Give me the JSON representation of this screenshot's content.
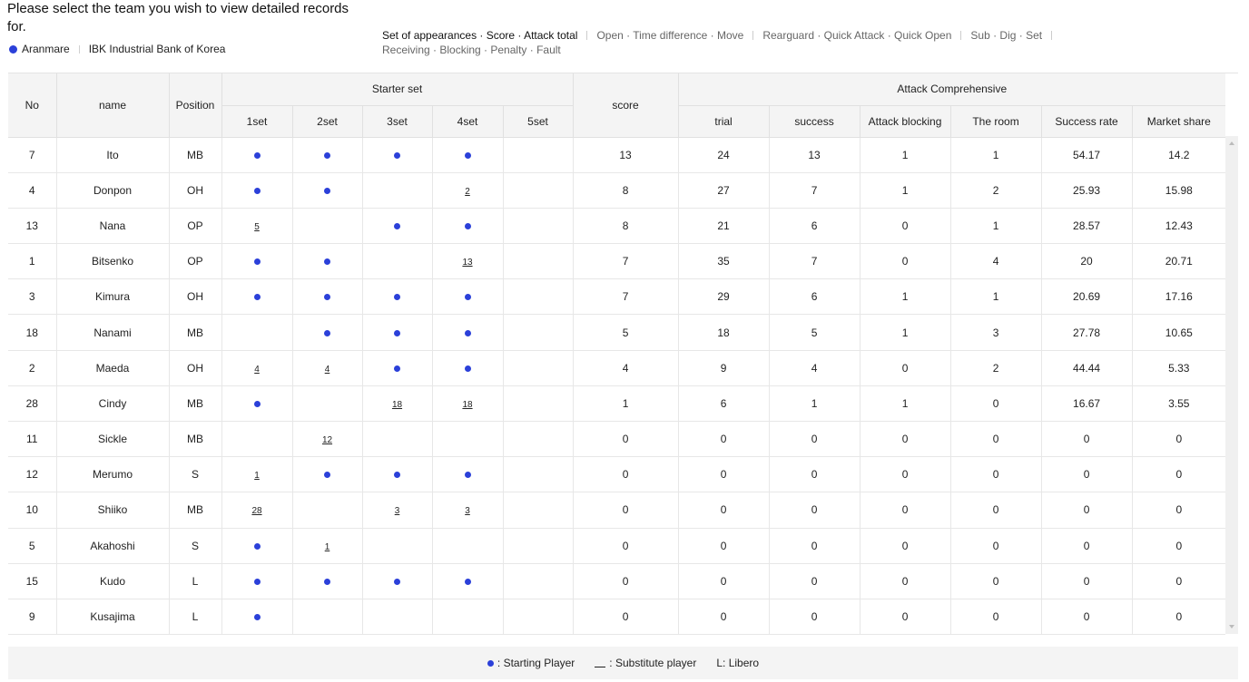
{
  "header": {
    "title": "Please select the team you wish to view detailed records for."
  },
  "teams": [
    {
      "label": "Aranmare",
      "selected": true
    },
    {
      "label": "IBK Industrial Bank of Korea",
      "selected": false
    }
  ],
  "categories": {
    "row1": [
      "Set of appearances · Score · Attack total",
      "Open · Time difference · Move",
      "Rearguard · Quick Attack · Quick Open",
      "Sub · Dig · Set"
    ],
    "row2": [
      "Receiving · Blocking · Penalty · Fault"
    ],
    "active": "Set of appearances · Score · Attack total"
  },
  "table": {
    "headers": {
      "no": "No",
      "name": "name",
      "position": "Position",
      "starter_set": "Starter set",
      "sets": [
        "1set",
        "2set",
        "3set",
        "4set",
        "5set"
      ],
      "score": "score",
      "attack": "Attack Comprehensive",
      "attack_cols": [
        "trial",
        "success",
        "Attack blocking",
        "The room",
        "Success rate",
        "Market share"
      ]
    },
    "rows": [
      {
        "no": "7",
        "name": "Ito",
        "pos": "MB",
        "sets": [
          "dot",
          "dot",
          "dot",
          "dot",
          ""
        ],
        "score": "13",
        "attack": [
          "24",
          "13",
          "1",
          "1",
          "54.17",
          "14.2"
        ]
      },
      {
        "no": "4",
        "name": "Donpon",
        "pos": "OH",
        "sets": [
          "dot",
          "dot",
          "",
          "2",
          ""
        ],
        "score": "8",
        "attack": [
          "27",
          "7",
          "1",
          "2",
          "25.93",
          "15.98"
        ]
      },
      {
        "no": "13",
        "name": "Nana",
        "pos": "OP",
        "sets": [
          "5",
          "",
          "dot",
          "dot",
          ""
        ],
        "score": "8",
        "attack": [
          "21",
          "6",
          "0",
          "1",
          "28.57",
          "12.43"
        ]
      },
      {
        "no": "1",
        "name": "Bitsenko",
        "pos": "OP",
        "sets": [
          "dot",
          "dot",
          "",
          "13",
          ""
        ],
        "score": "7",
        "attack": [
          "35",
          "7",
          "0",
          "4",
          "20",
          "20.71"
        ]
      },
      {
        "no": "3",
        "name": "Kimura",
        "pos": "OH",
        "sets": [
          "dot",
          "dot",
          "dot",
          "dot",
          ""
        ],
        "score": "7",
        "attack": [
          "29",
          "6",
          "1",
          "1",
          "20.69",
          "17.16"
        ]
      },
      {
        "no": "18",
        "name": "Nanami",
        "pos": "MB",
        "sets": [
          "",
          "dot",
          "dot",
          "dot",
          ""
        ],
        "score": "5",
        "attack": [
          "18",
          "5",
          "1",
          "3",
          "27.78",
          "10.65"
        ]
      },
      {
        "no": "2",
        "name": "Maeda",
        "pos": "OH",
        "sets": [
          "4",
          "4",
          "dot",
          "dot",
          ""
        ],
        "score": "4",
        "attack": [
          "9",
          "4",
          "0",
          "2",
          "44.44",
          "5.33"
        ]
      },
      {
        "no": "28",
        "name": "Cindy",
        "pos": "MB",
        "sets": [
          "dot",
          "",
          "18",
          "18",
          ""
        ],
        "score": "1",
        "attack": [
          "6",
          "1",
          "1",
          "0",
          "16.67",
          "3.55"
        ]
      },
      {
        "no": "11",
        "name": "Sickle",
        "pos": "MB",
        "sets": [
          "",
          "12",
          "",
          "",
          ""
        ],
        "score": "0",
        "attack": [
          "0",
          "0",
          "0",
          "0",
          "0",
          "0"
        ]
      },
      {
        "no": "12",
        "name": "Merumo",
        "pos": "S",
        "sets": [
          "1",
          "dot",
          "dot",
          "dot",
          ""
        ],
        "score": "0",
        "attack": [
          "0",
          "0",
          "0",
          "0",
          "0",
          "0"
        ]
      },
      {
        "no": "10",
        "name": "Shiiko",
        "pos": "MB",
        "sets": [
          "28",
          "",
          "3",
          "3",
          ""
        ],
        "score": "0",
        "attack": [
          "0",
          "0",
          "0",
          "0",
          "0",
          "0"
        ]
      },
      {
        "no": "5",
        "name": "Akahoshi",
        "pos": "S",
        "sets": [
          "dot",
          "1",
          "",
          "",
          ""
        ],
        "score": "0",
        "attack": [
          "0",
          "0",
          "0",
          "0",
          "0",
          "0"
        ]
      },
      {
        "no": "15",
        "name": "Kudo",
        "pos": "L",
        "sets": [
          "dot",
          "dot",
          "dot",
          "dot",
          ""
        ],
        "score": "0",
        "attack": [
          "0",
          "0",
          "0",
          "0",
          "0",
          "0"
        ]
      },
      {
        "no": "9",
        "name": "Kusajima",
        "pos": "L",
        "sets": [
          "dot",
          "",
          "",
          "",
          ""
        ],
        "score": "0",
        "attack": [
          "0",
          "0",
          "0",
          "0",
          "0",
          "0"
        ]
      }
    ]
  },
  "legend": {
    "starting": ": Starting Player",
    "substitute": ": Substitute player",
    "libero": "L: Libero"
  },
  "colors": {
    "accent": "#2b40d9",
    "header_bg": "#f4f4f4"
  }
}
